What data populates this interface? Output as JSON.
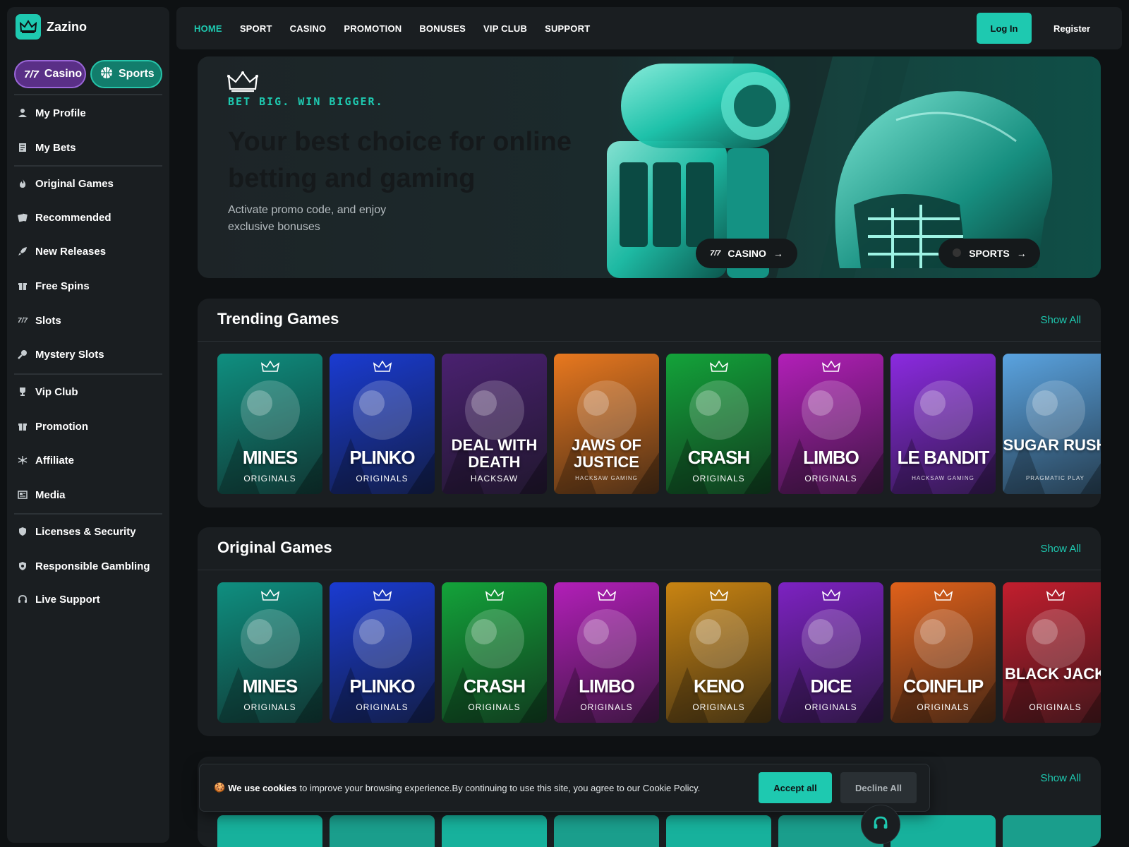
{
  "brand": {
    "name": "Zazino",
    "icon": "crown-icon",
    "accent": "#1ec9b0"
  },
  "mode_toggle": {
    "casino": {
      "label": "Casino",
      "icon": "casino-icon",
      "color": "#5a2f87"
    },
    "sports": {
      "label": "Sports",
      "icon": "basketball-icon",
      "color": "#127d6c"
    }
  },
  "sidebar": {
    "items": [
      {
        "label": "My Profile",
        "icon": "user-icon"
      },
      {
        "label": "My Bets",
        "icon": "receipt-icon"
      },
      {
        "label": "Original Games",
        "icon": "flame-icon"
      },
      {
        "label": "Recommended",
        "icon": "cards-icon"
      },
      {
        "label": "New Releases",
        "icon": "rocket-icon"
      },
      {
        "label": "Free Spins",
        "icon": "gift-icon"
      },
      {
        "label": "Slots",
        "icon": "slots-icon"
      },
      {
        "label": "Mystery Slots",
        "icon": "mystery-icon"
      },
      {
        "label": "Vip Club",
        "icon": "trophy-icon"
      },
      {
        "label": "Promotion",
        "icon": "gift-icon"
      },
      {
        "label": "Affiliate",
        "icon": "network-icon"
      },
      {
        "label": "Media",
        "icon": "media-icon"
      },
      {
        "label": "Licenses & Security",
        "icon": "shield-icon"
      },
      {
        "label": "Responsible Gambling",
        "icon": "shield-check-icon"
      },
      {
        "label": "Live Support",
        "icon": "headset-icon"
      }
    ]
  },
  "nav": {
    "links": [
      "HOME",
      "SPORT",
      "CASINO",
      "PROMOTION",
      "BONUSES",
      "VIP CLUB",
      "SUPPORT"
    ],
    "active": "HOME",
    "login": "Log In",
    "register": "Register"
  },
  "hero": {
    "tagline": "BET BIG. WIN BIGGER.",
    "title": "Your best choice for online betting and gaming",
    "subtitle": "Activate promo code, and enjoy exclusive bonuses",
    "casino_button": "CASINO",
    "sports_button": "SPORTS"
  },
  "trending": {
    "title": "Trending Games",
    "show_all": "Show All",
    "cards": [
      {
        "name": "MINES",
        "sub": "ORIGINALS",
        "color": "#0f8f80"
      },
      {
        "name": "PLINKO",
        "sub": "ORIGINALS",
        "color": "#1a3bd1"
      },
      {
        "name": "DEAL WITH DEATH",
        "sub": "HACKSAW",
        "color": "#4a2170"
      },
      {
        "name": "JAWS OF JUSTICE",
        "sub": "HACKSAW GAMING",
        "color": "#e8781f"
      },
      {
        "name": "CRASH",
        "sub": "ORIGINALS",
        "color": "#13a33a"
      },
      {
        "name": "LIMBO",
        "sub": "ORIGINALS",
        "color": "#b21fb8"
      },
      {
        "name": "LE BANDIT",
        "sub": "HACKSAW GAMING",
        "color": "#8b2ae0"
      },
      {
        "name": "SUGAR RUSH",
        "sub": "PRAGMATIC PLAY",
        "color": "#5aa3e0"
      }
    ]
  },
  "originals": {
    "title": "Original Games",
    "show_all": "Show All",
    "cards": [
      {
        "name": "MINES",
        "sub": "ORIGINALS",
        "color": "#0f8f80"
      },
      {
        "name": "PLINKO",
        "sub": "ORIGINALS",
        "color": "#1a3bd1"
      },
      {
        "name": "CRASH",
        "sub": "ORIGINALS",
        "color": "#13a33a"
      },
      {
        "name": "LIMBO",
        "sub": "ORIGINALS",
        "color": "#b21fb8"
      },
      {
        "name": "KENO",
        "sub": "ORIGINALS",
        "color": "#c98412"
      },
      {
        "name": "DICE",
        "sub": "ORIGINALS",
        "color": "#7d22c2"
      },
      {
        "name": "COINFLIP",
        "sub": "ORIGINALS",
        "color": "#e0611a"
      },
      {
        "name": "BLACK JACK",
        "sub": "ORIGINALS",
        "color": "#c21e2e"
      }
    ]
  },
  "third_section": {
    "show_all": "Show All"
  },
  "cookie": {
    "bold": "We use cookies",
    "text": "to improve your browsing experience.By continuing to use this site, you agree to our Cookie Policy.",
    "accept": "Accept all",
    "decline": "Decline All"
  }
}
